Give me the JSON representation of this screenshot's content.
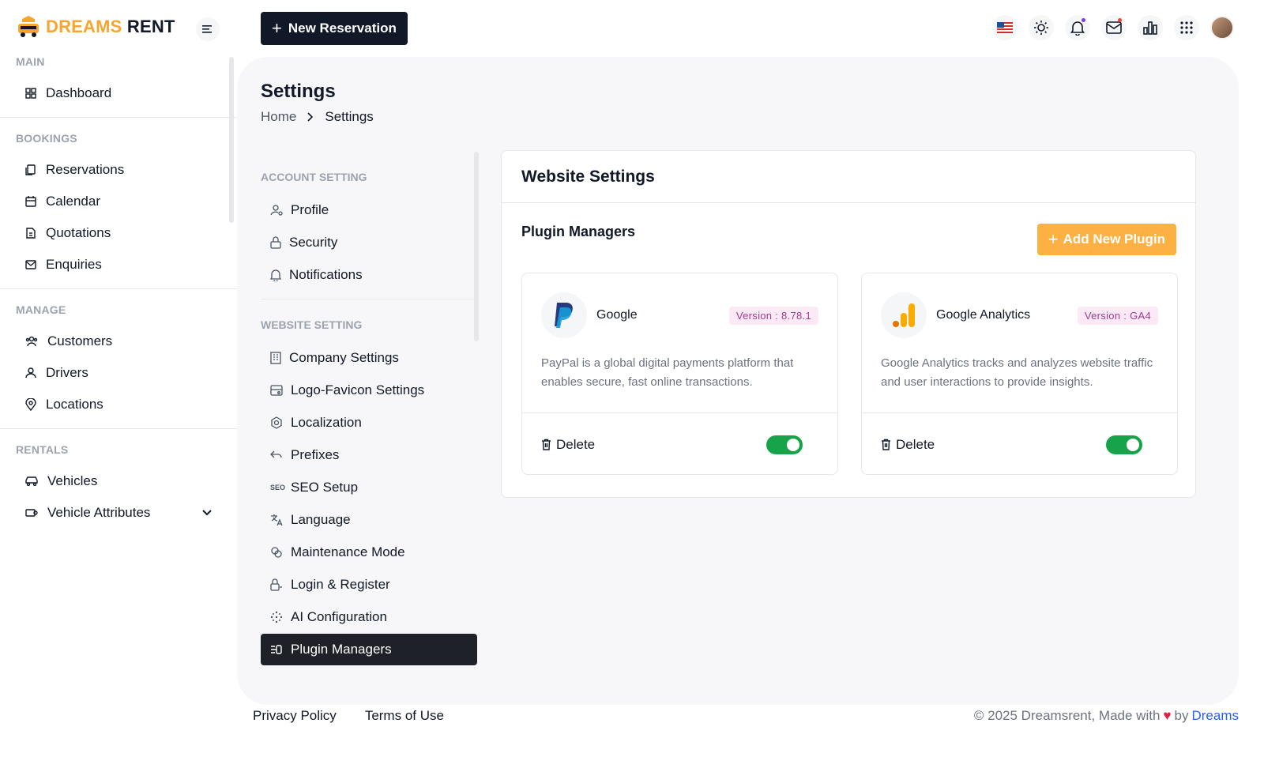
{
  "app": {
    "logo_part1": "DREAMS",
    "logo_part2": "RENT"
  },
  "header": {
    "new_reservation_label": "New Reservation",
    "icons": [
      "flag-us-icon",
      "sun-icon",
      "bell-icon",
      "mail-icon",
      "chart-icon",
      "apps-grid-icon",
      "user-avatar"
    ]
  },
  "sidebar": {
    "sections": [
      {
        "title": "MAIN",
        "items": [
          {
            "label": "Dashboard",
            "icon": "dashboard-icon"
          }
        ]
      },
      {
        "title": "BOOKINGS",
        "items": [
          {
            "label": "Reservations",
            "icon": "reservations-icon"
          },
          {
            "label": "Calendar",
            "icon": "calendar-icon"
          },
          {
            "label": "Quotations",
            "icon": "quotations-icon"
          },
          {
            "label": "Enquiries",
            "icon": "mail-icon"
          }
        ]
      },
      {
        "title": "MANAGE",
        "items": [
          {
            "label": "Customers",
            "icon": "users-icon"
          },
          {
            "label": "Drivers",
            "icon": "driver-icon"
          },
          {
            "label": "Locations",
            "icon": "location-icon"
          }
        ]
      },
      {
        "title": "RENTALS",
        "items": [
          {
            "label": "Vehicles",
            "icon": "car-icon"
          },
          {
            "label": "Vehicle Attributes",
            "icon": "car-attributes-icon"
          }
        ]
      }
    ]
  },
  "page": {
    "title": "Settings",
    "breadcrumb": {
      "home": "Home",
      "current": "Settings"
    }
  },
  "settings_nav": {
    "account_title": "ACCOUNT SETTING",
    "account_items": [
      {
        "label": "Profile",
        "icon": "profile-icon"
      },
      {
        "label": "Security",
        "icon": "lock-icon"
      },
      {
        "label": "Notifications",
        "icon": "bell-icon"
      }
    ],
    "website_title": "WEBSITE SETTING",
    "website_items": [
      {
        "label": "Company Settings",
        "icon": "building-icon"
      },
      {
        "label": "Logo-Favicon Settings",
        "icon": "image-icon"
      },
      {
        "label": "Localization",
        "icon": "hexagon-icon"
      },
      {
        "label": "Prefixes",
        "icon": "arrow-back-icon"
      },
      {
        "label": "SEO Setup",
        "icon": "seo-icon"
      },
      {
        "label": "Language",
        "icon": "translate-icon"
      },
      {
        "label": "Maintenance Mode",
        "icon": "maintenance-icon"
      },
      {
        "label": "Login & Register",
        "icon": "lock-icon"
      },
      {
        "label": "AI Configuration",
        "icon": "ai-icon"
      },
      {
        "label": "Plugin Managers",
        "icon": "plugin-icon",
        "active": true
      }
    ]
  },
  "card": {
    "title": "Website Settings",
    "section_title": "Plugin Managers",
    "add_plugin_label": "Add New Plugin",
    "plugins": [
      {
        "name": "Google",
        "version": "Version : 8.78.1",
        "description": "PayPal is a global digital payments platform that enables secure, fast online transactions.",
        "delete_label": "Delete",
        "enabled": true,
        "icon": "paypal-logo-icon"
      },
      {
        "name": "Google Analytics",
        "version": "Version : GA4",
        "description": "Google Analytics tracks and analyzes website traffic and user interactions to provide insights.",
        "delete_label": "Delete",
        "enabled": true,
        "icon": "google-analytics-logo-icon"
      }
    ]
  },
  "footer": {
    "privacy": "Privacy Policy",
    "terms": "Terms of Use",
    "copyright": "© 2025 Dreamsrent, Made with",
    "by": "by",
    "brand": "Dreams"
  },
  "colors": {
    "accent": "#fdb143",
    "dark": "#111827",
    "toggle_on": "#16a34a",
    "version_text": "#a23b8c"
  }
}
